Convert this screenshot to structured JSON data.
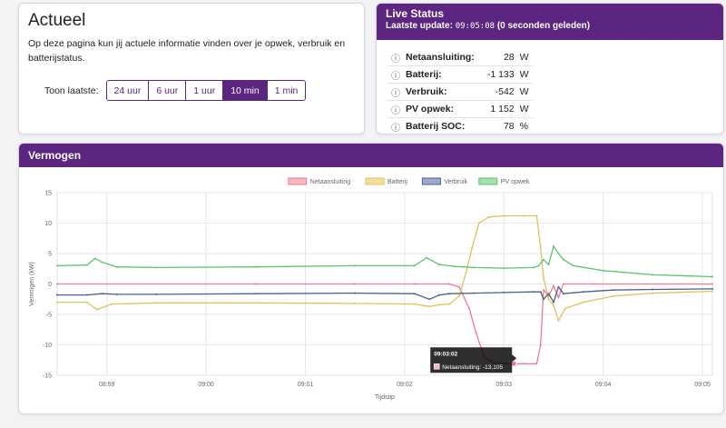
{
  "actueel": {
    "title": "Actueel",
    "description": "Op deze pagina kun jij actuele informatie vinden over je opwek, verbruik en batterijstatus.",
    "range_label": "Toon laatste:",
    "range_options": [
      "24 uur",
      "6 uur",
      "1 uur",
      "10 min",
      "1 min"
    ],
    "range_selected": "10 min"
  },
  "live_status": {
    "title": "Live Status",
    "update_label": "Laatste update:",
    "update_time": "09:05:08",
    "update_ago": "(0 seconden geleden)",
    "rows": [
      {
        "label": "Netaansluiting:",
        "value": "28",
        "unit": "W"
      },
      {
        "label": "Batterij:",
        "value": "-1 133",
        "unit": "W"
      },
      {
        "label": "Verbruik:",
        "value": "-542",
        "unit": "W"
      },
      {
        "label": "PV opwek:",
        "value": "1 152",
        "unit": "W"
      },
      {
        "label": "Batterij SOC:",
        "value": "78",
        "unit": "%"
      }
    ],
    "info_icon": "info-icon"
  },
  "vermogen": {
    "title": "Vermogen"
  },
  "chart_data": {
    "type": "line",
    "title": "",
    "xlabel": "Tijdstip",
    "ylabel": "Vermogen (kW)",
    "ylim": [
      -15,
      15
    ],
    "yticks": [
      15,
      10,
      5,
      0,
      -5,
      -10,
      -15
    ],
    "xticks": [
      {
        "label": "08:59",
        "t": 0.5
      },
      {
        "label": "09:00",
        "t": 1.5
      },
      {
        "label": "09:01",
        "t": 2.5
      },
      {
        "label": "09:02",
        "t": 3.5
      },
      {
        "label": "09:03",
        "t": 4.5
      },
      {
        "label": "09:04",
        "t": 5.5
      },
      {
        "label": "09:05",
        "t": 6.5
      }
    ],
    "xlim": [
      0,
      6.6
    ],
    "grid": true,
    "legend_position": "top",
    "series": [
      {
        "name": "Netaansluiting",
        "color": "#f07a8e",
        "fill": "#f8b7c3",
        "points": [
          [
            0,
            0
          ],
          [
            2.0,
            0
          ],
          [
            3.0,
            0
          ],
          [
            3.6,
            0
          ],
          [
            3.95,
            0
          ],
          [
            4.05,
            -0.5
          ],
          [
            4.15,
            -4
          ],
          [
            4.22,
            -8
          ],
          [
            4.3,
            -12
          ],
          [
            4.4,
            -13
          ],
          [
            4.5,
            -13.1
          ],
          [
            4.7,
            -13.1
          ],
          [
            4.83,
            -13.1
          ],
          [
            4.87,
            -10
          ],
          [
            4.9,
            -1
          ],
          [
            4.95,
            -2
          ],
          [
            5.0,
            -0.3
          ],
          [
            5.05,
            -2.2
          ],
          [
            5.1,
            0
          ],
          [
            5.4,
            0
          ],
          [
            6.6,
            0
          ]
        ]
      },
      {
        "name": "Batterij",
        "color": "#e0c25a",
        "fill": "#f2dfa0",
        "points": [
          [
            0,
            -3
          ],
          [
            0.3,
            -3
          ],
          [
            0.4,
            -4.2
          ],
          [
            0.55,
            -3.3
          ],
          [
            1.0,
            -3.1
          ],
          [
            2.0,
            -3.1
          ],
          [
            3.0,
            -3.2
          ],
          [
            3.6,
            -3.3
          ],
          [
            3.75,
            -3.7
          ],
          [
            3.85,
            -3.4
          ],
          [
            3.95,
            -3.3
          ],
          [
            4.05,
            -2
          ],
          [
            4.12,
            2
          ],
          [
            4.18,
            6
          ],
          [
            4.25,
            10
          ],
          [
            4.35,
            11
          ],
          [
            4.5,
            11.2
          ],
          [
            4.7,
            11.2
          ],
          [
            4.83,
            11.2
          ],
          [
            4.87,
            6
          ],
          [
            4.9,
            1
          ],
          [
            4.95,
            -2.5
          ],
          [
            5.0,
            -3.5
          ],
          [
            5.05,
            -6
          ],
          [
            5.12,
            -4
          ],
          [
            5.3,
            -3
          ],
          [
            5.6,
            -2
          ],
          [
            6.0,
            -1.5
          ],
          [
            6.6,
            -1.2
          ]
        ]
      },
      {
        "name": "Verbruik",
        "color": "#4a5f8f",
        "fill": "#9aaac8",
        "points": [
          [
            0,
            -1.8
          ],
          [
            0.3,
            -1.8
          ],
          [
            0.45,
            -1.6
          ],
          [
            0.6,
            -1.7
          ],
          [
            1.0,
            -1.7
          ],
          [
            2.0,
            -1.6
          ],
          [
            3.0,
            -1.5
          ],
          [
            3.6,
            -1.6
          ],
          [
            3.75,
            -2.5
          ],
          [
            3.85,
            -1.8
          ],
          [
            3.95,
            -1.6
          ],
          [
            4.2,
            -1.5
          ],
          [
            4.5,
            -1.4
          ],
          [
            4.8,
            -1.3
          ],
          [
            4.87,
            -1.3
          ],
          [
            4.9,
            -2.5
          ],
          [
            4.95,
            -1.6
          ],
          [
            5.0,
            -3.0
          ],
          [
            5.05,
            -0.5
          ],
          [
            5.1,
            -1.6
          ],
          [
            5.3,
            -1.3
          ],
          [
            5.6,
            -1.0
          ],
          [
            6.0,
            -0.9
          ],
          [
            6.6,
            -0.8
          ]
        ]
      },
      {
        "name": "PV opwek",
        "color": "#5cc46a",
        "fill": "#a5e0ad",
        "points": [
          [
            0,
            3.0
          ],
          [
            0.3,
            3.1
          ],
          [
            0.38,
            4.2
          ],
          [
            0.45,
            3.6
          ],
          [
            0.6,
            2.8
          ],
          [
            1.0,
            2.7
          ],
          [
            2.0,
            2.8
          ],
          [
            3.0,
            3.0
          ],
          [
            3.6,
            3.0
          ],
          [
            3.72,
            4.3
          ],
          [
            3.85,
            3.2
          ],
          [
            4.0,
            2.9
          ],
          [
            4.2,
            2.7
          ],
          [
            4.5,
            2.6
          ],
          [
            4.8,
            2.7
          ],
          [
            4.85,
            3.0
          ],
          [
            4.9,
            4.0
          ],
          [
            4.95,
            3.2
          ],
          [
            5.0,
            6.2
          ],
          [
            5.05,
            5.0
          ],
          [
            5.1,
            4.0
          ],
          [
            5.2,
            3.0
          ],
          [
            5.5,
            2.2
          ],
          [
            6.0,
            1.5
          ],
          [
            6.6,
            1.2
          ]
        ]
      }
    ],
    "tooltip": {
      "title": "09:03:02",
      "label": "Netaansluiting: -13,105",
      "t": 4.6,
      "y": -13.1
    }
  }
}
